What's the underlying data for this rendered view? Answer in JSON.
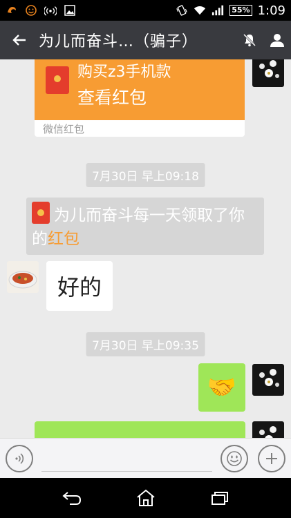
{
  "status_bar": {
    "battery": "55%",
    "time": "1:09"
  },
  "header": {
    "title": "为儿而奋斗…（骗子）"
  },
  "red_packet": {
    "description": "购买z3手机款",
    "action": "查看红包",
    "footer": "微信红包"
  },
  "timestamps": [
    "7月30日 早上09:18",
    "7月30日 早上09:35"
  ],
  "notice": {
    "text_before": "为儿而奋斗每一天领取了你的",
    "highlight": "红包"
  },
  "messages": {
    "received_text": "好的",
    "sent_emoji": "🤝"
  },
  "input": {
    "placeholder": ""
  },
  "colors": {
    "title_bar": "#393a3f",
    "red_packet_orange": "#f79c33",
    "sent_bubble_green": "#9fe658",
    "timestamp_gray": "#d6d6d6"
  },
  "icons": [
    "uc-browser-icon",
    "smiley-status-icon",
    "hotspot-icon",
    "image-icon",
    "vibrate-icon",
    "wifi-icon",
    "signal-icon",
    "back-arrow-icon",
    "mute-icon",
    "profile-icon",
    "voice-icon",
    "emoji-icon",
    "plus-icon",
    "nav-back-icon",
    "nav-home-icon",
    "nav-recents-icon"
  ]
}
